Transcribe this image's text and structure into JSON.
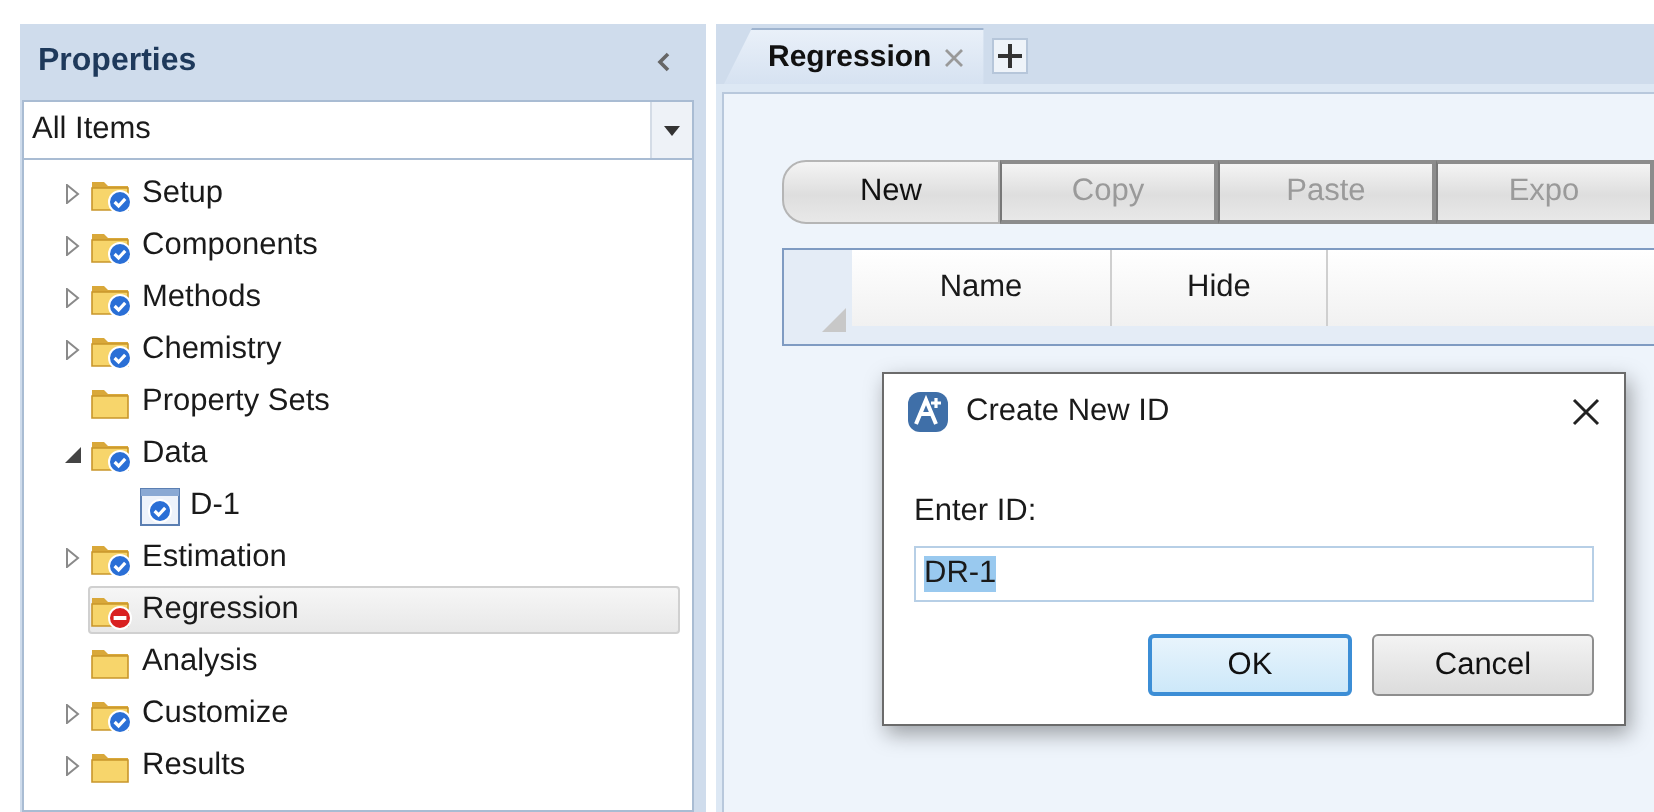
{
  "panel": {
    "title": "Properties",
    "filter": "All Items"
  },
  "tree": [
    {
      "label": "Setup",
      "kind": "folder-check",
      "expanded": false,
      "selected": false
    },
    {
      "label": "Components",
      "kind": "folder-check",
      "expanded": false,
      "selected": false
    },
    {
      "label": "Methods",
      "kind": "folder-check",
      "expanded": false,
      "selected": false
    },
    {
      "label": "Chemistry",
      "kind": "folder-check",
      "expanded": false,
      "selected": false
    },
    {
      "label": "Property Sets",
      "kind": "folder",
      "selected": false
    },
    {
      "label": "Data",
      "kind": "folder-check",
      "expanded": true,
      "selected": false,
      "children": [
        {
          "label": "D-1",
          "kind": "form-check",
          "selected": false
        }
      ]
    },
    {
      "label": "Estimation",
      "kind": "folder-check",
      "expanded": false,
      "selected": false
    },
    {
      "label": "Regression",
      "kind": "folder-error",
      "selected": true
    },
    {
      "label": "Analysis",
      "kind": "folder",
      "selected": false
    },
    {
      "label": "Customize",
      "kind": "folder-check",
      "expanded": false,
      "selected": false
    },
    {
      "label": "Results",
      "kind": "folder",
      "expanded": false,
      "selected": false
    }
  ],
  "tabs": [
    {
      "label": "Regression",
      "selected": true
    }
  ],
  "toolbar": [
    {
      "label": "New",
      "disabled": false
    },
    {
      "label": "Copy",
      "disabled": true
    },
    {
      "label": "Paste",
      "disabled": true
    },
    {
      "label": "Expo",
      "disabled": true
    }
  ],
  "grid": {
    "columns": [
      "Name",
      "Hide"
    ]
  },
  "dialog": {
    "title": "Create New ID",
    "label": "Enter ID:",
    "value": "DR-1",
    "value_selected": true,
    "buttons": [
      {
        "label": "OK",
        "default": true
      },
      {
        "label": "Cancel",
        "default": false
      }
    ]
  }
}
